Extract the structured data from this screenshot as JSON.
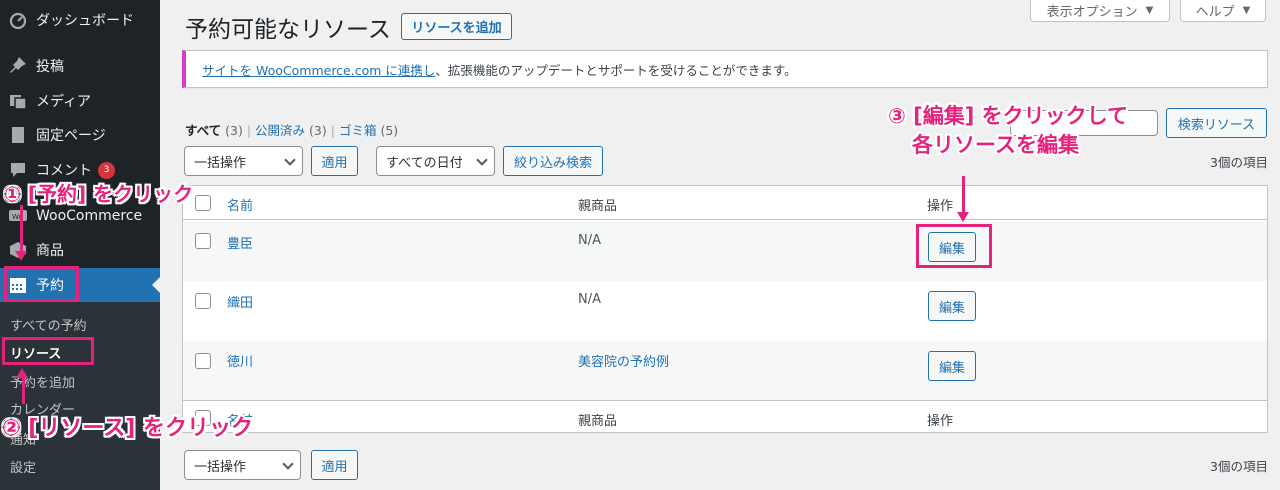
{
  "sidebar": {
    "items": [
      {
        "label": "ダッシュボード",
        "icon": "dashboard-icon"
      },
      {
        "label": "投稿",
        "icon": "pin-icon"
      },
      {
        "label": "メディア",
        "icon": "media-icon"
      },
      {
        "label": "固定ページ",
        "icon": "page-icon"
      },
      {
        "label": "コメント",
        "icon": "comment-icon",
        "badge": "3"
      },
      {
        "label": "WooCommerce",
        "icon": "woocommerce-icon"
      },
      {
        "label": "商品",
        "icon": "product-icon"
      },
      {
        "label": "予約",
        "icon": "calendar-icon"
      }
    ],
    "submenu": [
      "すべての予約",
      "リソース",
      "予約を追加",
      "カレンダー",
      "通知",
      "設定"
    ]
  },
  "top_buttons": {
    "screen_options": "表示オプション",
    "help": "ヘルプ"
  },
  "header": {
    "title": "予約可能なリソース",
    "add_button": "リソースを追加"
  },
  "notice": {
    "link": "サイトを WooCommerce.com に連携し",
    "text": "、拡張機能のアップデートとサポートを受けることができます。"
  },
  "views": {
    "all": "すべて",
    "all_count": "(3)",
    "published": "公開済み",
    "published_count": "(3)",
    "trash": "ゴミ箱",
    "trash_count": "(5)",
    "sep": "|"
  },
  "filters": {
    "bulk_action": "一括操作",
    "apply": "適用",
    "date": "すべての日付",
    "filter": "絞り込み検索",
    "search_button": "検索リソース"
  },
  "item_count": "3個の項目",
  "table": {
    "columns": [
      "名前",
      "親商品",
      "操作"
    ],
    "rows": [
      {
        "name": "豊臣",
        "parent": "N/A",
        "action": "編集"
      },
      {
        "name": "織田",
        "parent": "N/A",
        "action": "編集"
      },
      {
        "name": "徳川",
        "parent": "美容院の予約例",
        "action": "編集"
      }
    ]
  },
  "annotations": {
    "step1": "① [予約] をクリック",
    "step2": "② [リソース] をクリック",
    "step3_line1": "③ [編集] をクリックして",
    "step3_line2": "各リソースを編集"
  },
  "colors": {
    "accent": "#2271b1",
    "annotation": "#e6237c",
    "sidebar": "#1d2327"
  }
}
